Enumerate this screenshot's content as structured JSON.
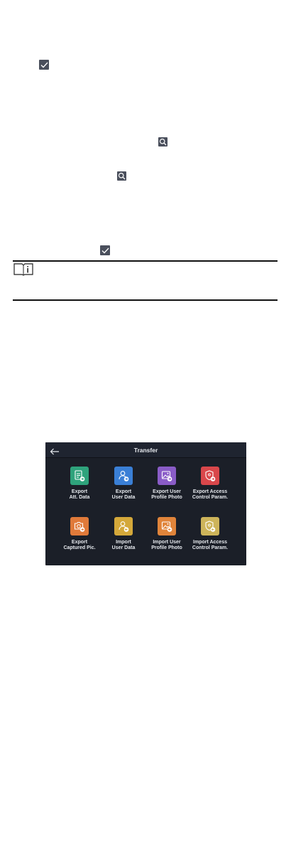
{
  "doc": {
    "inline_icons": [
      "check-icon",
      "search-icon",
      "search-icon",
      "check-icon"
    ],
    "note_icon": "info-note-icon"
  },
  "transfer_screen": {
    "title": "Transfer",
    "back_icon": "back-arrow-icon",
    "tiles": [
      {
        "line1": "Export",
        "line2": "Att. Data",
        "color": "#2fa37c",
        "icon": "document-export-icon"
      },
      {
        "line1": "Export",
        "line2": "User Data",
        "color": "#3a7fd6",
        "icon": "user-export-icon"
      },
      {
        "line1": "Export User",
        "line2": "Profile Photo",
        "color": "#8a5cc7",
        "icon": "photo-export-icon"
      },
      {
        "line1": "Export Access",
        "line2": "Control Param.",
        "color": "#d9474b",
        "icon": "shield-export-icon"
      },
      {
        "line1": "Export",
        "line2": "Captured Pic.",
        "color": "#e07a3a",
        "icon": "camera-export-icon"
      },
      {
        "line1": "Import",
        "line2": "User Data",
        "color": "#d4a83a",
        "icon": "user-import-icon"
      },
      {
        "line1": "Import User",
        "line2": "Profile Photo",
        "color": "#e0843a",
        "icon": "photo-import-icon"
      },
      {
        "line1": "Import Access",
        "line2": "Control Param.",
        "color": "#cdb45a",
        "icon": "shield-import-icon"
      }
    ]
  }
}
